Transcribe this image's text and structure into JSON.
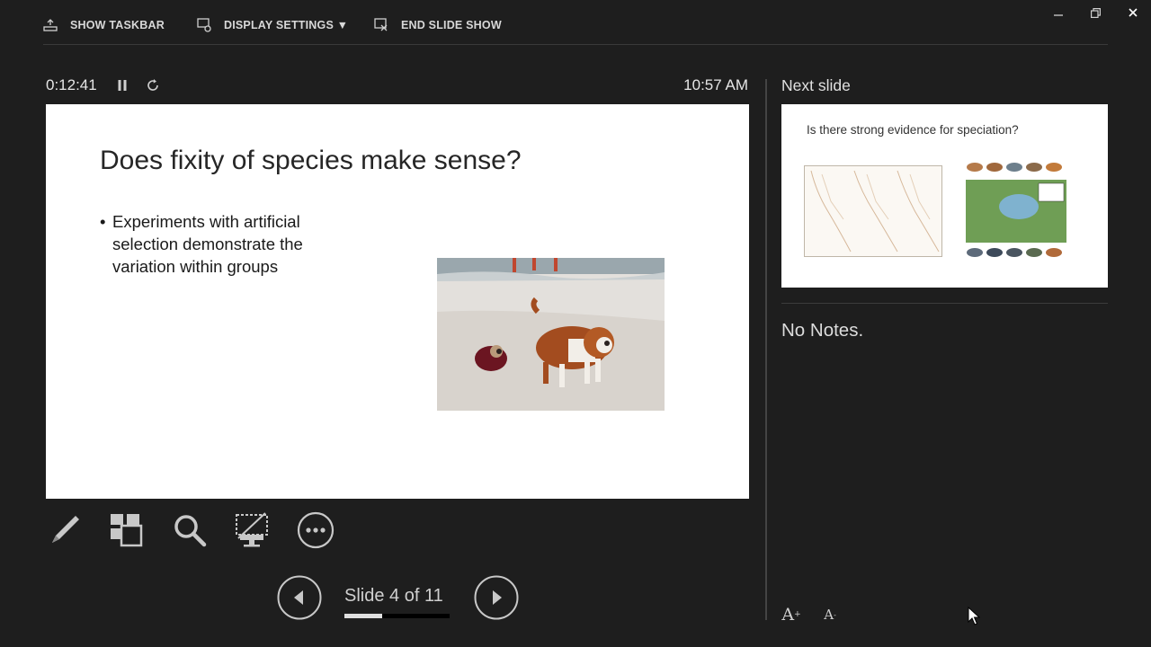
{
  "toolbar": {
    "show_taskbar": "SHOW TASKBAR",
    "display_settings": "DISPLAY SETTINGS ▼",
    "end_slide_show": "END SLIDE SHOW"
  },
  "timer": {
    "elapsed": "0:12:41",
    "clock": "10:57 AM"
  },
  "current_slide": {
    "title": "Does fixity of species make sense?",
    "bullets": [
      "Experiments with artificial selection demonstrate the variation within groups"
    ]
  },
  "navigation": {
    "slide_counter": "Slide 4 of 11",
    "current": 4,
    "total": 11,
    "progress_fraction": 0.36
  },
  "next_slide": {
    "label": "Next slide",
    "title": "Is there strong evidence for speciation?"
  },
  "notes": {
    "text": "No Notes."
  },
  "icons": {
    "toolbar": [
      "taskbar-icon",
      "display-settings-icon",
      "end-show-icon"
    ],
    "window": [
      "minimize-icon",
      "restore-icon",
      "close-icon"
    ],
    "timer": [
      "pause-icon",
      "restart-icon"
    ],
    "tools": [
      "pen-icon",
      "see-all-slides-icon",
      "zoom-icon",
      "black-screen-icon",
      "more-options-icon"
    ],
    "nav": [
      "previous-icon",
      "next-icon"
    ],
    "font": [
      "increase-font-icon",
      "decrease-font-icon"
    ]
  },
  "colors": {
    "background": "#1e1e1e",
    "slide_bg": "#ffffff",
    "text": "#e0e0e0"
  }
}
